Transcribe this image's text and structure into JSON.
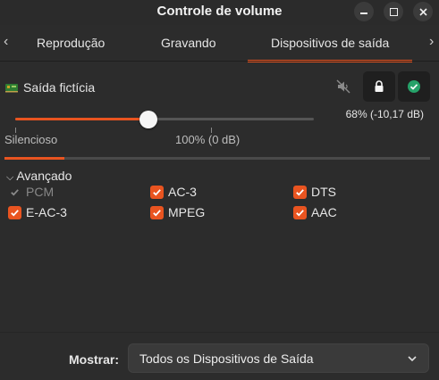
{
  "window": {
    "title": "Controle de volume"
  },
  "tabs": [
    {
      "label": "Reprodução"
    },
    {
      "label": "Gravando"
    },
    {
      "label": "Dispositivos de saída",
      "active": true
    }
  ],
  "device": {
    "name": "Saída fictícia",
    "volume_readout": "68% (-10,17 dB)",
    "volume_fraction": 0.68,
    "level_fraction": 0.14,
    "marks": {
      "min": "Silencioso",
      "normal": "100% (0 dB)"
    }
  },
  "advanced": {
    "label": "Avançado",
    "formats": [
      {
        "label": "PCM",
        "checked": true,
        "disabled": true
      },
      {
        "label": "AC-3",
        "checked": true,
        "disabled": false
      },
      {
        "label": "DTS",
        "checked": true,
        "disabled": false
      },
      {
        "label": "E-AC-3",
        "checked": true,
        "disabled": false
      },
      {
        "label": "MPEG",
        "checked": true,
        "disabled": false
      },
      {
        "label": "AAC",
        "checked": true,
        "disabled": false
      }
    ]
  },
  "footer": {
    "show_label": "Mostrar:",
    "show_value": "Todos os Dispositivos de Saída"
  },
  "icons": {
    "minimize": "minimize-icon",
    "maximize": "maximize-icon",
    "close": "close-icon",
    "device": "sound-card-icon",
    "mute": "speaker-muted-icon",
    "lock": "lock-icon",
    "default": "check-circle-icon"
  },
  "colors": {
    "accent": "#e95420",
    "success": "#26a269"
  }
}
